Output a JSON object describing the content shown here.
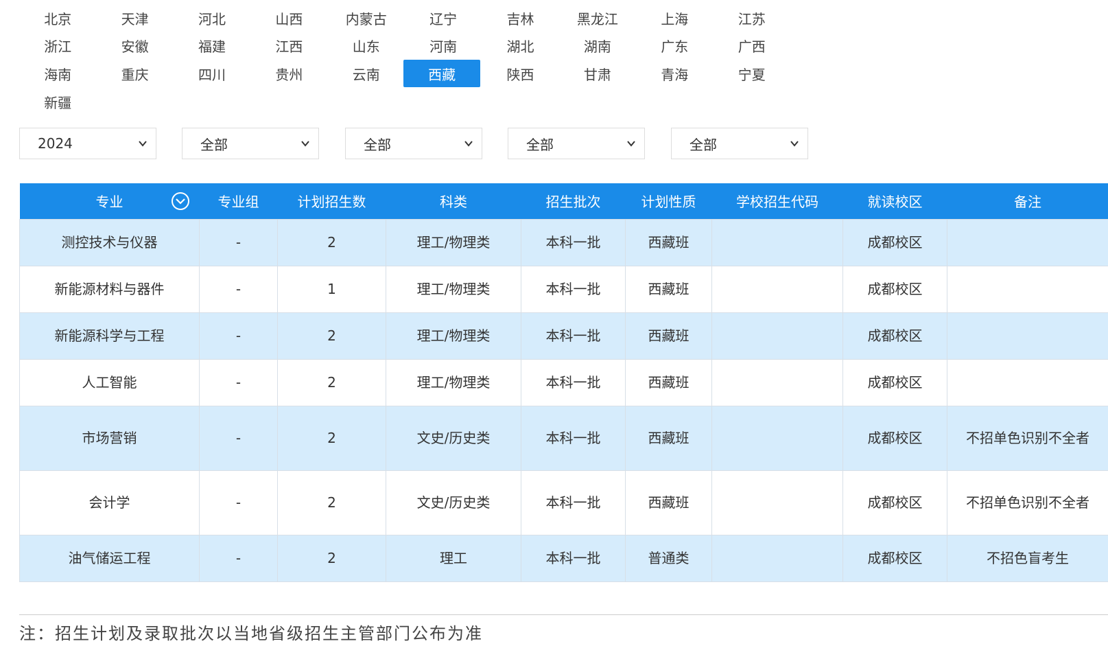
{
  "provinces": [
    [
      "北京",
      "天津",
      "河北",
      "山西",
      "内蒙古",
      "辽宁",
      "吉林",
      "黑龙江",
      "上海",
      "江苏"
    ],
    [
      "浙江",
      "安徽",
      "福建",
      "江西",
      "山东",
      "河南",
      "湖北",
      "湖南",
      "广东",
      "广西"
    ],
    [
      "海南",
      "重庆",
      "四川",
      "贵州",
      "云南",
      "西藏",
      "陕西",
      "甘肃",
      "青海",
      "宁夏"
    ],
    [
      "新疆"
    ]
  ],
  "selected_province": "西藏",
  "filters": {
    "year": "2024",
    "f2": "全部",
    "f3": "全部",
    "f4": "全部",
    "f5": "全部"
  },
  "table": {
    "headers": [
      "专业",
      "专业组",
      "计划招生数",
      "科类",
      "招生批次",
      "计划性质",
      "学校招生代码",
      "就读校区",
      "备注"
    ],
    "rows": [
      [
        "测控技术与仪器",
        "-",
        "2",
        "理工/物理类",
        "本科一批",
        "西藏班",
        "",
        "成都校区",
        ""
      ],
      [
        "新能源材料与器件",
        "-",
        "1",
        "理工/物理类",
        "本科一批",
        "西藏班",
        "",
        "成都校区",
        ""
      ],
      [
        "新能源科学与工程",
        "-",
        "2",
        "理工/物理类",
        "本科一批",
        "西藏班",
        "",
        "成都校区",
        ""
      ],
      [
        "人工智能",
        "-",
        "2",
        "理工/物理类",
        "本科一批",
        "西藏班",
        "",
        "成都校区",
        ""
      ],
      [
        "市场营销",
        "-",
        "2",
        "文史/历史类",
        "本科一批",
        "西藏班",
        "",
        "成都校区",
        "不招单色识别不全者"
      ],
      [
        "会计学",
        "-",
        "2",
        "文史/历史类",
        "本科一批",
        "西藏班",
        "",
        "成都校区",
        "不招单色识别不全者"
      ],
      [
        "油气储运工程",
        "-",
        "2",
        "理工",
        "本科一批",
        "普通类",
        "",
        "成都校区",
        "不招色盲考生"
      ]
    ]
  },
  "note": "注：招生计划及录取批次以当地省级招生主管部门公布为准",
  "colors": {
    "accent": "#1a8be8",
    "row_highlight": "#d6ecfc"
  }
}
